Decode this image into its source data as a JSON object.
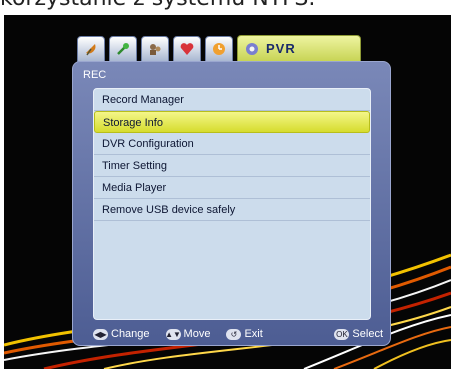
{
  "caption": "korzystanie z systemu NTFS.",
  "tabs": [
    {
      "icon": "satellite-dish-icon"
    },
    {
      "icon": "tools-icon"
    },
    {
      "icon": "parental-lock-icon"
    },
    {
      "icon": "heart-icon"
    },
    {
      "icon": "clock-icon"
    }
  ],
  "active_tab": {
    "icon": "pvr-icon",
    "label": "PVR"
  },
  "panel_title": "REC",
  "menu_items": [
    "Record Manager",
    "Storage Info",
    "DVR Configuration",
    "Timer Setting",
    "Media Player",
    "Remove USB device safely"
  ],
  "selected_index": 1,
  "hints": {
    "change": "Change",
    "move": "Move",
    "exit": "Exit",
    "select": "Select",
    "change_glyph": "◀▶",
    "move_glyph": "▲▼",
    "exit_glyph": "↺",
    "select_glyph": "OK"
  },
  "colors": {
    "panel": "#5a6aa0",
    "list": "#ccdcec",
    "highlight": "#e6ea4a",
    "active_tab": "#dfe78a"
  }
}
